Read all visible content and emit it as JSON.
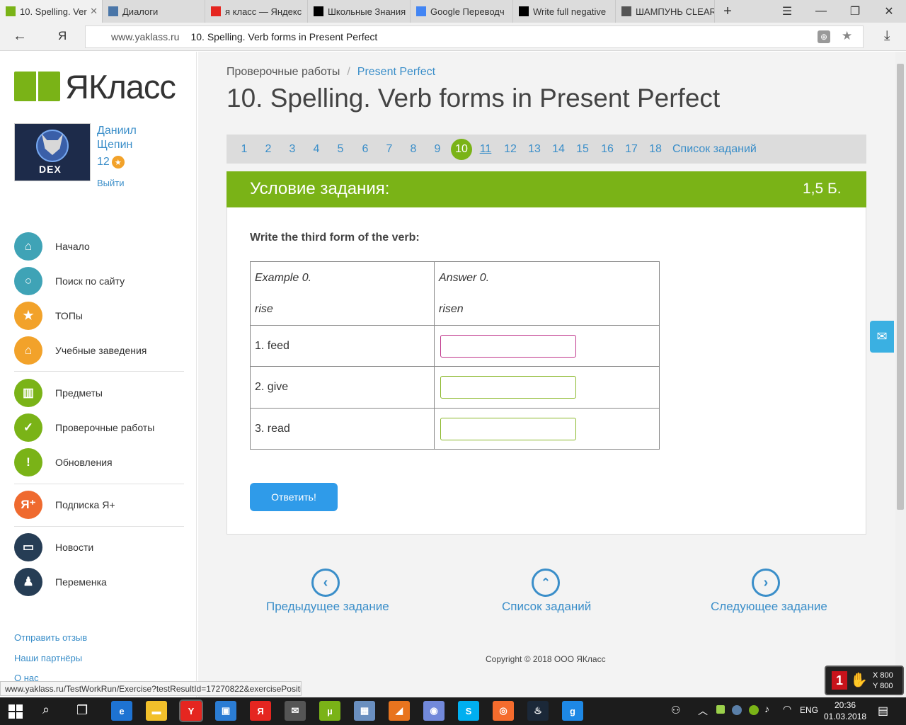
{
  "browser": {
    "tabs": [
      {
        "title": "10. Spelling. Ver",
        "icon": "yaklass-favicon",
        "color": "#7ab317",
        "active": true
      },
      {
        "title": "Диалоги",
        "icon": "vk-favicon",
        "color": "#4a76a8"
      },
      {
        "title": "я класс — Яндекс",
        "icon": "yandex-favicon",
        "color": "#e52620"
      },
      {
        "title": "Школьные Знания",
        "icon": "znanija-favicon",
        "color": "#000000"
      },
      {
        "title": "Google Переводч",
        "icon": "google-translate-favicon",
        "color": "#4285f4"
      },
      {
        "title": "Write full negative",
        "icon": "znanija-favicon",
        "color": "#000000"
      },
      {
        "title": "ШАМПУНЬ CLEAR",
        "icon": "person-favicon",
        "color": "#555555"
      }
    ],
    "new_tab": "+",
    "url_domain": "www.yaklass.ru",
    "url_title": "10. Spelling. Verb forms in Present Perfect",
    "status_url": "www.yaklass.ru/TestWorkRun/Exercise?testResultId=17270822&exercisePositi..."
  },
  "sidebar": {
    "logo_text": "ЯКласс",
    "user": {
      "first_name": "Даниил",
      "last_name": "Щепин",
      "points": "12",
      "logout": "Выйти",
      "avatar_text": "DEX"
    },
    "nav": [
      {
        "label": "Начало",
        "icon": "home-icon",
        "color": "#3fa3b6"
      },
      {
        "label": "Поиск по сайту",
        "icon": "search-icon",
        "color": "#3fa3b6"
      },
      {
        "label": "ТОПы",
        "icon": "star-icon",
        "color": "#f2a22a"
      },
      {
        "label": "Учебные заведения",
        "icon": "institution-icon",
        "color": "#f2a22a"
      },
      {
        "label": "Предметы",
        "icon": "book-icon",
        "color": "#7ab317"
      },
      {
        "label": "Проверочные работы",
        "icon": "check-icon",
        "color": "#7ab317"
      },
      {
        "label": "Обновления",
        "icon": "exclamation-icon",
        "color": "#7ab317"
      },
      {
        "label": "Подписка Я+",
        "icon": "yaplus-icon",
        "color": "#ef6a2f"
      },
      {
        "label": "Новости",
        "icon": "chat-icon",
        "color": "#263d55"
      },
      {
        "label": "Переменка",
        "icon": "bell-icon",
        "color": "#263d55"
      }
    ],
    "footer_links": [
      "Отправить отзыв",
      "Наши партнёры",
      "О нас"
    ]
  },
  "main": {
    "breadcrumb": {
      "parent": "Проверочные работы",
      "separator": "/",
      "current": "Present Perfect"
    },
    "title": "10. Spelling. Verb forms in Present Perfect",
    "pagination": {
      "pages": [
        "1",
        "2",
        "3",
        "4",
        "5",
        "6",
        "7",
        "8",
        "9",
        "10",
        "11",
        "12",
        "13",
        "14",
        "15",
        "16",
        "17",
        "18"
      ],
      "current": "10",
      "list_link": "Список заданий"
    },
    "task": {
      "header": "Условие задания:",
      "points": "1,5 Б.",
      "instruction": "Write the third form of the verb:",
      "example_label": "Example 0.",
      "example_word": "rise",
      "answer_label": "Answer 0.",
      "answer_word": "risen",
      "rows": [
        {
          "word": "1. feed",
          "value": ""
        },
        {
          "word": "2. give",
          "value": ""
        },
        {
          "word": "3. read",
          "value": ""
        }
      ],
      "submit": "Ответить!"
    },
    "bottom_nav": {
      "prev": "Предыдущее задание",
      "list": "Список заданий",
      "next": "Следующее задание"
    },
    "copyright": "Copyright © 2018 ООО ЯКласс"
  },
  "overlay": {
    "number": "1",
    "x_label": "X 800",
    "y_label": "Y 800"
  },
  "taskbar": {
    "lang": "ENG",
    "time": "20:36",
    "date": "01.03.2018",
    "apps": [
      {
        "icon": "edge-icon",
        "color": "#1e73d2",
        "glyph": "e"
      },
      {
        "icon": "file-explorer-icon",
        "color": "#f2c02b",
        "glyph": "▬"
      },
      {
        "icon": "yandex-browser-icon",
        "color": "#e52620",
        "glyph": "Y"
      },
      {
        "icon": "store-icon",
        "color": "#2b7cd3",
        "glyph": "▣"
      },
      {
        "icon": "yandex-icon",
        "color": "#e52620",
        "glyph": "Я"
      },
      {
        "icon": "mail-icon",
        "color": "#555555",
        "glyph": "✉"
      },
      {
        "icon": "utorrent-icon",
        "color": "#7ab317",
        "glyph": "µ"
      },
      {
        "icon": "photos-icon",
        "color": "#6a8fbf",
        "glyph": "▦"
      },
      {
        "icon": "winamp-icon",
        "color": "#e8741e",
        "glyph": "◢"
      },
      {
        "icon": "discord-icon",
        "color": "#7289da",
        "glyph": "◉"
      },
      {
        "icon": "skype-icon",
        "color": "#00aff0",
        "glyph": "S"
      },
      {
        "icon": "origin-icon",
        "color": "#f56c2d",
        "glyph": "◎"
      },
      {
        "icon": "steam-icon",
        "color": "#1b2838",
        "glyph": "♨"
      },
      {
        "icon": "gmod-icon",
        "color": "#1e88e5",
        "glyph": "g"
      }
    ]
  }
}
